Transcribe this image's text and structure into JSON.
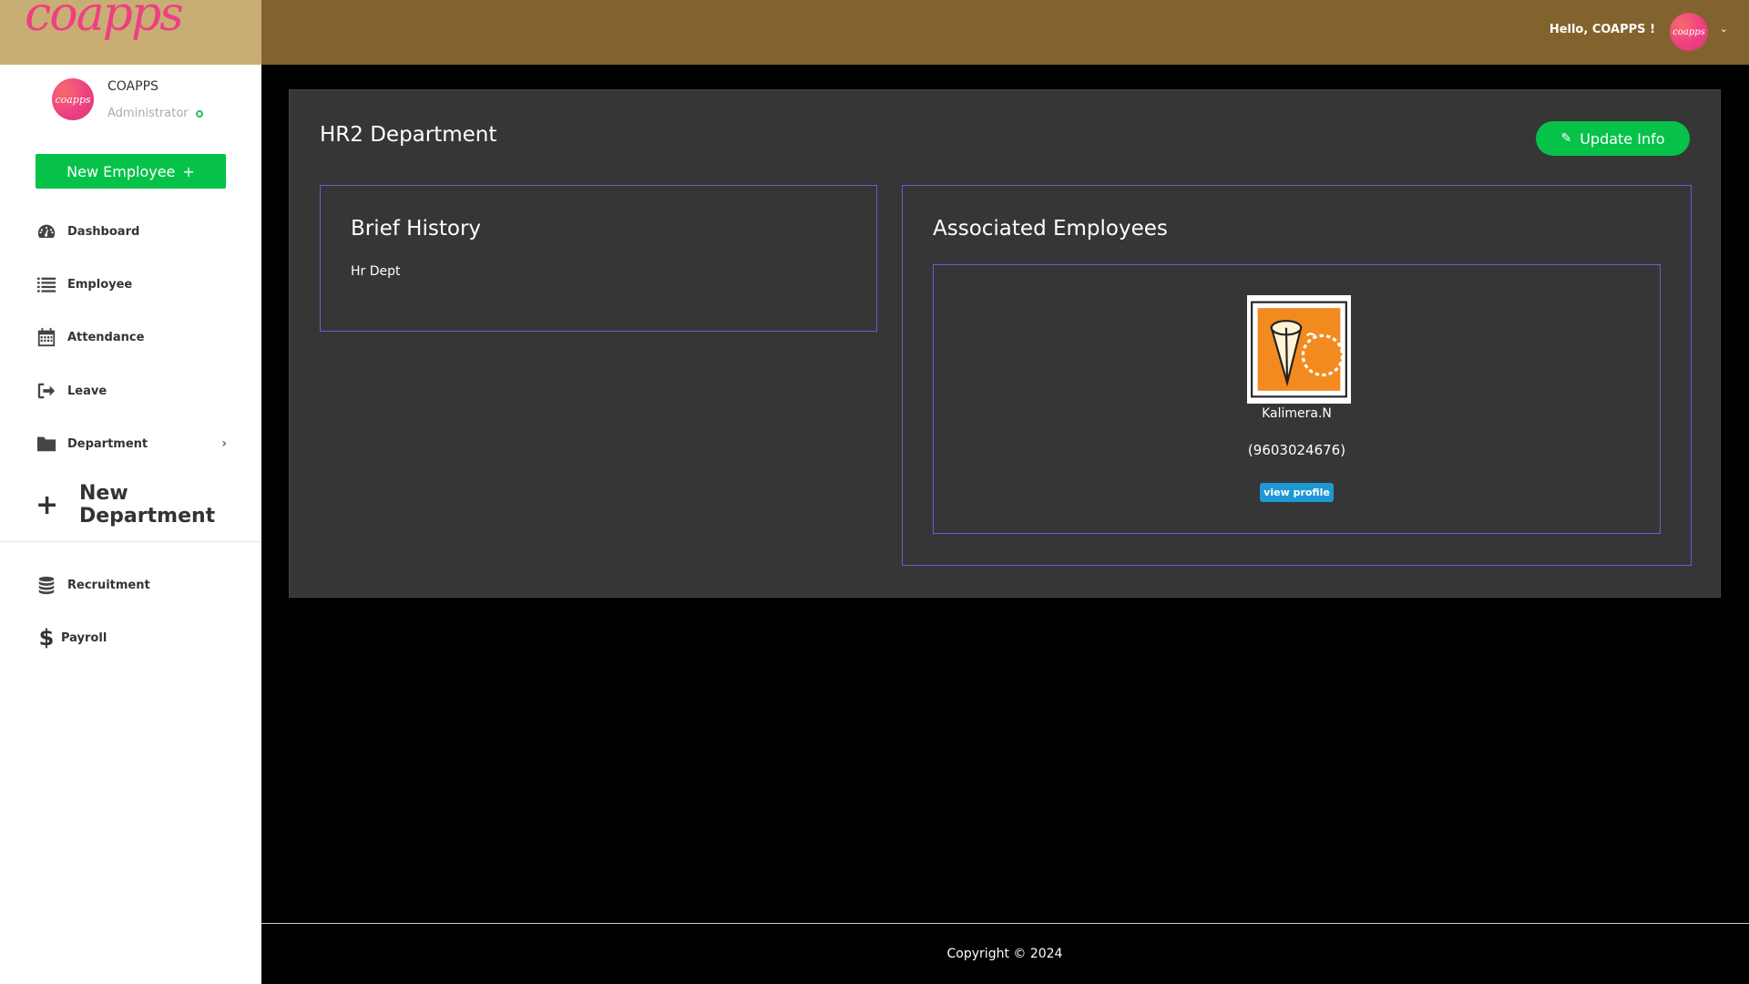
{
  "brand": {
    "logo_text": "coapps"
  },
  "user": {
    "name": "COAPPS",
    "role": "Administrator",
    "avatar_text": "coapps"
  },
  "sidebar": {
    "new_employee_label": "New Employee",
    "new_employee_plus": "+",
    "items": [
      {
        "label": "Dashboard",
        "icon": "dashboard-icon"
      },
      {
        "label": "Employee",
        "icon": "list-icon"
      },
      {
        "label": "Attendance",
        "icon": "calendar-icon"
      },
      {
        "label": "Leave",
        "icon": "sign-out-icon"
      },
      {
        "label": "Department",
        "icon": "folder-icon"
      },
      {
        "label": "New Department",
        "icon": "plus-icon"
      },
      {
        "label": "Recruitment",
        "icon": "database-icon"
      },
      {
        "label": "Payroll",
        "icon": "dollar-icon"
      }
    ]
  },
  "topbar": {
    "greeting": "Hello, COAPPS !",
    "avatar_text": "coapps"
  },
  "main": {
    "title": "HR2 Department",
    "update_button_label": "Update Info",
    "history": {
      "title": "Brief History",
      "text": "Hr Dept"
    },
    "associated": {
      "title": "Associated Employees",
      "employees": [
        {
          "name": "Kalimera.N",
          "phone": "(9603024676)",
          "view_label": "view profile"
        }
      ]
    }
  },
  "footer": {
    "copyright": "Copyright © 2024"
  },
  "colors": {
    "accent_green": "#06c249",
    "topbar": "#82632d",
    "brand_bg": "#c8ae74",
    "border_purple": "#6d5ad6",
    "link_blue": "#1e98d4"
  }
}
